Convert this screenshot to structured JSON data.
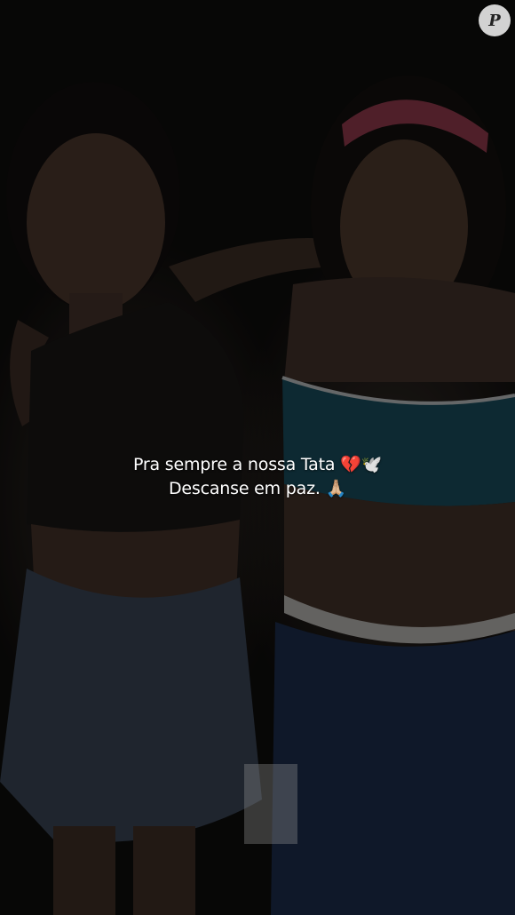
{
  "caption": {
    "line1": "Pra sempre a nossa Tata 💔🕊️",
    "line2": "Descanse em paz. 🙏🏼"
  },
  "watermark": {
    "letter": "P",
    "icon": "purepeople-logo-icon"
  },
  "photo": {
    "description_icon": "photo-background-icon",
    "colors": {
      "skin": "#3a2a22",
      "black_top": "#121110",
      "teal_top": "#123946",
      "denim_skirt": "#2b3440",
      "jeans": "#16223a",
      "headband": "#6e2b3a"
    }
  }
}
